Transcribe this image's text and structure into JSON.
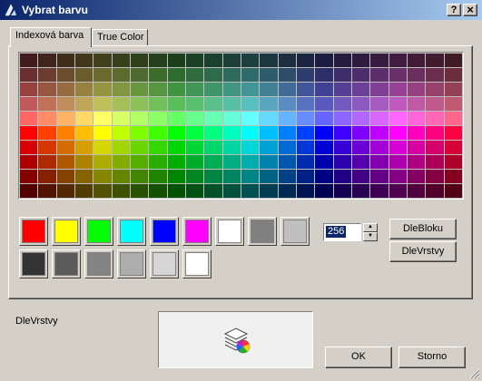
{
  "window": {
    "title": "Vybrat barvu",
    "help_button": "?",
    "close_button": "×"
  },
  "tabs": [
    {
      "label": "Indexová barva",
      "active": true
    },
    {
      "label": "True Color",
      "active": false
    }
  ],
  "color_grid": {
    "columns": 24,
    "rows": 10,
    "hue_step_degrees": 15,
    "row_lightness_percent": [
      18,
      30,
      42,
      55,
      70,
      50,
      42,
      34,
      26,
      16
    ],
    "row_saturation_percent": [
      40,
      40,
      40,
      45,
      100,
      100,
      100,
      100,
      100,
      100
    ]
  },
  "standard_colors": {
    "row1": [
      "#ff0000",
      "#ffff00",
      "#00ff00",
      "#00ffff",
      "#0000ff",
      "#ff00ff",
      "#ffffff",
      "#808080",
      "#c0c0c0"
    ],
    "row2": [
      "#333333",
      "#5b5b5b",
      "#848484",
      "#adadad",
      "#d6d6d6",
      "#ffffff"
    ]
  },
  "color_index": {
    "value": "256",
    "up_arrow": "▲",
    "down_arrow": "▼"
  },
  "buttons": {
    "by_block": "DleBloku",
    "by_layer": "DleVrstvy",
    "ok": "OK",
    "cancel": "Storno"
  },
  "selected_color_label": "DleVrstvy",
  "preview_icon": "layers-color-icon"
}
